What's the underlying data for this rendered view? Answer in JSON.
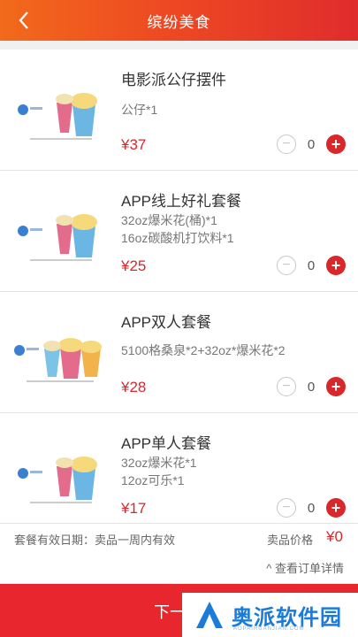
{
  "header": {
    "title": "缤纷美食"
  },
  "items": [
    {
      "name": "电影派公仔摆件",
      "desc1": "公仔*1",
      "desc2": "",
      "price": "¥37",
      "qty": "0",
      "minus": "−",
      "plus": "+"
    },
    {
      "name": "APP线上好礼套餐",
      "desc1": "32oz爆米花(桶)*1",
      "desc2": "16oz碳酸机打饮料*1",
      "price": "¥25",
      "qty": "0",
      "minus": "−",
      "plus": "+"
    },
    {
      "name": "APP双人套餐",
      "desc1": "5100格桑泉*2+32oz*爆米花*2",
      "desc2": "",
      "price": "¥28",
      "qty": "0",
      "minus": "−",
      "plus": "+"
    },
    {
      "name": "APP单人套餐",
      "desc1": "32oz爆米花*1",
      "desc2": "12oz可乐*1",
      "price": "¥17",
      "qty": "0",
      "minus": "−",
      "plus": "+"
    }
  ],
  "summary": {
    "validity": "套餐有效日期：卖品一周内有效",
    "price_label": "卖品价格",
    "total": "¥0",
    "details": "^ 查看订单详情"
  },
  "bottom": {
    "next_label": "下一"
  },
  "watermark": {
    "text": "奥派软件园",
    "sub": "AOPAIRUANJIAN.COM"
  },
  "colors": {
    "accent": "#d9282c",
    "header_start": "#f26a1b",
    "header_end": "#e02c2c"
  }
}
